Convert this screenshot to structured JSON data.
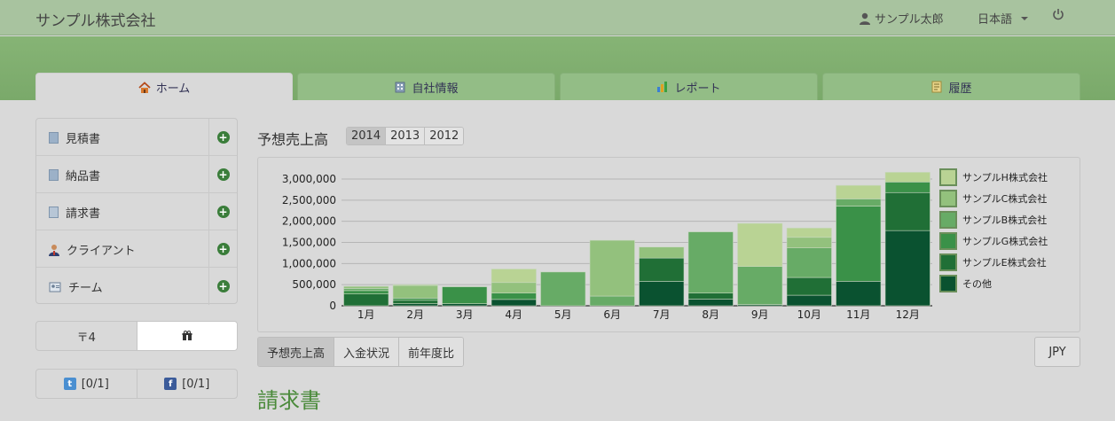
{
  "header": {
    "brand": "サンプル株式会社",
    "user_name": "サンプル太郎",
    "language": "日本語"
  },
  "tabs": [
    {
      "label": "ホーム",
      "icon": "home-icon",
      "active": true
    },
    {
      "label": "自社情報",
      "icon": "building-icon",
      "active": false
    },
    {
      "label": "レポート",
      "icon": "bar-chart-icon",
      "active": false
    },
    {
      "label": "履歴",
      "icon": "history-icon",
      "active": false
    }
  ],
  "sidebar": {
    "items": [
      {
        "label": "見積書",
        "icon": "document-icon"
      },
      {
        "label": "納品書",
        "icon": "document-icon"
      },
      {
        "label": "請求書",
        "icon": "invoice-icon"
      },
      {
        "label": "クライアント",
        "icon": "person-icon"
      },
      {
        "label": "チーム",
        "icon": "team-icon"
      }
    ],
    "postal_label": "〒4",
    "gift_icon": "gift-icon",
    "twitter_count": "[0/1]",
    "facebook_count": "[0/1]"
  },
  "main": {
    "title": "予想売上高",
    "years": [
      "2014",
      "2013",
      "2012"
    ],
    "selected_year": "2014",
    "sub_tabs": [
      "予想売上高",
      "入金状況",
      "前年度比"
    ],
    "currency": "JPY",
    "section_heading": "請求書"
  },
  "chart_data": {
    "type": "bar",
    "stacked": true,
    "categories": [
      "1月",
      "2月",
      "3月",
      "4月",
      "5月",
      "6月",
      "7月",
      "8月",
      "9月",
      "10月",
      "11月",
      "12月"
    ],
    "ylim": [
      0,
      3000000
    ],
    "yticks": [
      "0",
      "500,000",
      "1,000,000",
      "1,500,000",
      "2,000,000",
      "2,500,000",
      "3,000,000"
    ],
    "grid": true,
    "legend_position": "right",
    "series": [
      {
        "name": "その他",
        "color": "#0a5230",
        "values": [
          0,
          50000,
          50000,
          150000,
          0,
          0,
          580000,
          160000,
          30000,
          250000,
          580000,
          1780000
        ]
      },
      {
        "name": "サンプルE株式会社",
        "color": "#206f36",
        "values": [
          280000,
          80000,
          0,
          0,
          0,
          0,
          550000,
          140000,
          0,
          420000,
          0,
          900000
        ]
      },
      {
        "name": "サンプルG株式会社",
        "color": "#3a9148",
        "values": [
          80000,
          50000,
          400000,
          150000,
          0,
          0,
          0,
          0,
          0,
          0,
          1780000,
          250000
        ]
      },
      {
        "name": "サンプルB株式会社",
        "color": "#67ab66",
        "values": [
          50000,
          0,
          0,
          0,
          800000,
          230000,
          0,
          1450000,
          900000,
          700000,
          170000,
          0
        ]
      },
      {
        "name": "サンプルC株式会社",
        "color": "#93c17d",
        "values": [
          50000,
          300000,
          0,
          250000,
          0,
          1320000,
          260000,
          0,
          0,
          250000,
          0,
          0
        ]
      },
      {
        "name": "サンプルH株式会社",
        "color": "#b9d394",
        "values": [
          0,
          20000,
          0,
          320000,
          0,
          0,
          0,
          0,
          1020000,
          220000,
          320000,
          230000
        ]
      }
    ]
  },
  "colors": {
    "accent": "#4a8a3a",
    "header_bg": "#a8c39f",
    "banner_bg": "#7fae6e"
  }
}
